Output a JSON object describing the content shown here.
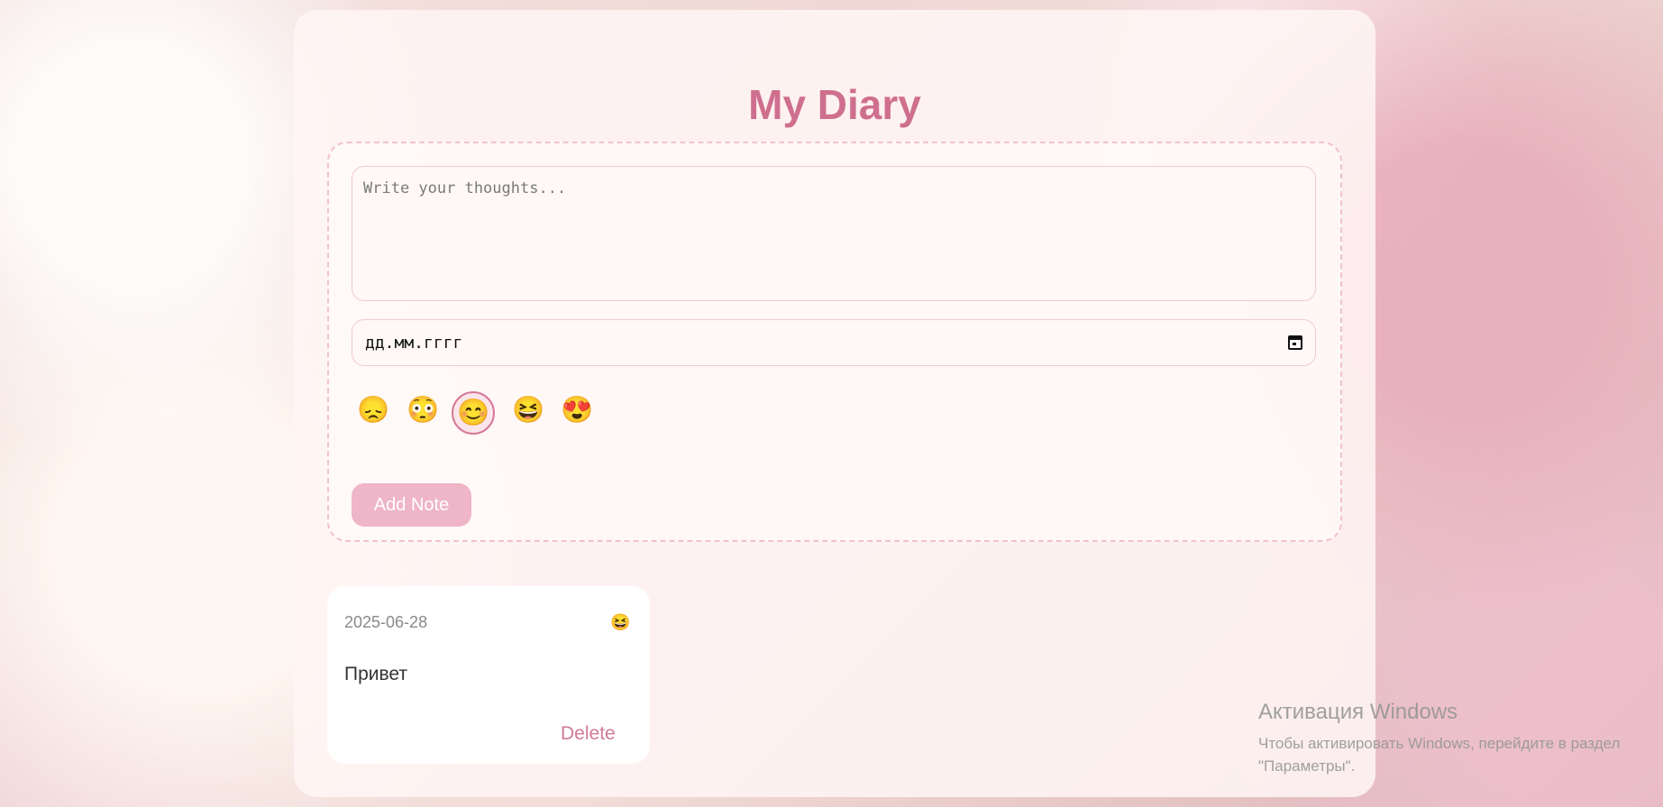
{
  "app": {
    "title": "My Diary"
  },
  "form": {
    "textarea_placeholder": "Write your thoughts...",
    "date_placeholder": "дд.мм.гггг",
    "moods": [
      {
        "emoji": "😞",
        "name": "sad",
        "selected": false
      },
      {
        "emoji": "😳",
        "name": "awkward",
        "selected": false
      },
      {
        "emoji": "😊",
        "name": "happy",
        "selected": true
      },
      {
        "emoji": "😆",
        "name": "laughing",
        "selected": false
      },
      {
        "emoji": "😍",
        "name": "love",
        "selected": false
      }
    ],
    "add_button_label": "Add Note"
  },
  "notes": [
    {
      "date": "2025-06-28",
      "mood": "😆",
      "text": "Привет",
      "delete_label": "Delete"
    }
  ],
  "windows_watermark": {
    "title": "Активация Windows",
    "text": "Чтобы активировать Windows, перейдите в раздел \"Параметры\"."
  },
  "colors": {
    "accent": "#cf6f8f",
    "button": "#efb5c8",
    "border": "#f1c2d2"
  }
}
